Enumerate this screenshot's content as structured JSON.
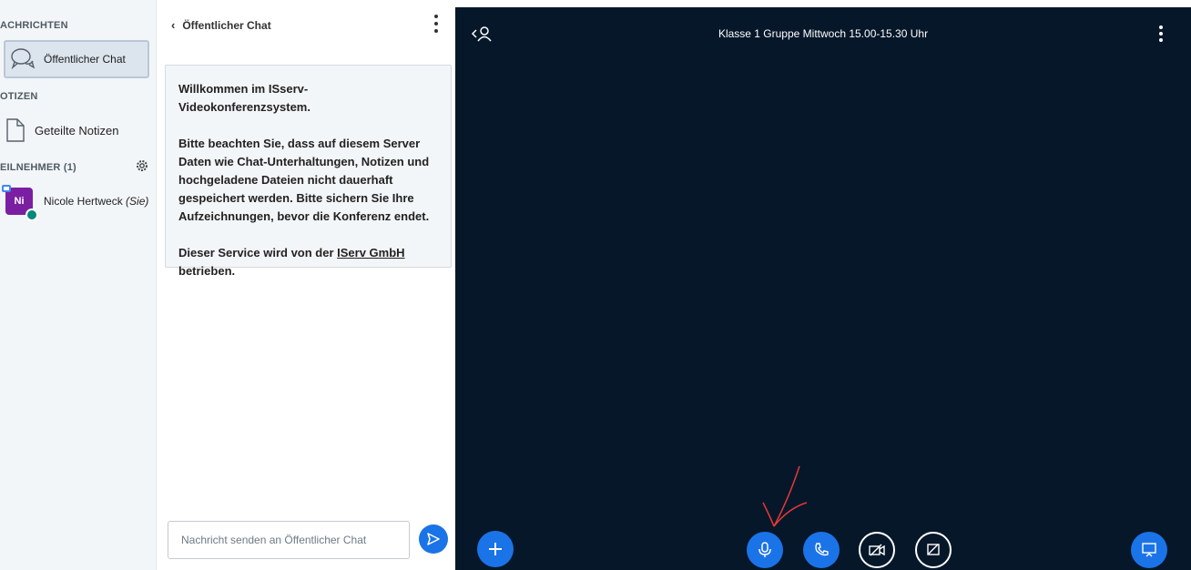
{
  "sidebar": {
    "messages_title": "ACHRICHTEN",
    "chat_item_label": "Öffentlicher Chat",
    "notes_title": "OTIZEN",
    "notes_item_label": "Geteilte Notizen",
    "participants_title": "EILNEHMER (1)",
    "user": {
      "initials": "Ni",
      "name": "Nicole Hertweck",
      "you_suffix": "(Sie)"
    }
  },
  "chat": {
    "title": "Öffentlicher Chat",
    "welcome": {
      "line1": "Willkommen im ISserv-Videokonferenzsystem.",
      "line2": "Bitte beachten Sie, dass auf diesem Server Daten wie Chat-Unterhaltungen, Notizen und hochgeladene Dateien nicht dauerhaft gespeichert werden. Bitte sichern Sie Ihre Aufzeichnungen, bevor die Konferenz endet.",
      "line3_prefix": "Dieser Service wird von der ",
      "line3_link": "IServ GmbH",
      "line3_suffix": " betrieben."
    },
    "input_placeholder": "Nachricht senden an Öffentlicher Chat"
  },
  "stage": {
    "title": "Klasse 1 Gruppe Mittwoch 15.00-15.30 Uhr"
  },
  "colors": {
    "accent": "#1b73e8",
    "stage_bg": "#06172a",
    "avatar": "#7b1fa2",
    "annotation": "#e53935"
  },
  "icons": [
    "chat-bubbles-icon",
    "notes-document-icon",
    "gear-icon",
    "back-chevron-icon",
    "kebab-menu-icon",
    "send-icon",
    "user-toggle-icon",
    "plus-icon",
    "microphone-icon",
    "phone-icon",
    "camera-off-icon",
    "screenshare-off-icon",
    "presentation-icon"
  ]
}
